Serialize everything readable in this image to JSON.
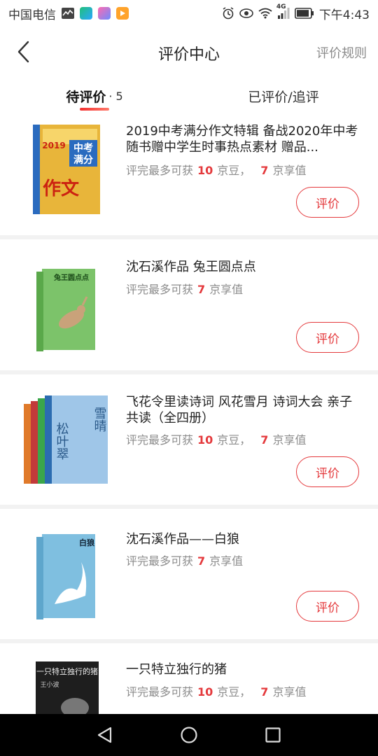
{
  "status_bar": {
    "carrier": "中国电信",
    "network": "4G",
    "time": "下午4:43"
  },
  "header": {
    "title": "评价中心",
    "rules_label": "评价规则"
  },
  "tabs": [
    {
      "label": "待评价",
      "count": "· 5"
    },
    {
      "label": "已评价/追评"
    }
  ],
  "items": [
    {
      "title": "2019中考满分作文特辑 备战2020年中考 随书赠中学生时事热点素材 赠品...",
      "reward_prefix": "评完最多可获",
      "bean_count": "10",
      "bean_label": "京豆，",
      "value_count": "7",
      "value_label": "京享值",
      "button": "评价"
    },
    {
      "title": "沈石溪作品 兔王圆点点",
      "reward_prefix": "评完最多可获",
      "value_count": "7",
      "value_label": "京享值",
      "button": "评价"
    },
    {
      "title": "飞花令里读诗词 风花雪月 诗词大会 亲子共读（全四册）",
      "reward_prefix": "评完最多可获",
      "bean_count": "10",
      "bean_label": "京豆，",
      "value_count": "7",
      "value_label": "京享值",
      "button": "评价"
    },
    {
      "title": "沈石溪作品——白狼",
      "reward_prefix": "评完最多可获",
      "value_count": "7",
      "value_label": "京享值",
      "button": "评价"
    },
    {
      "title": "一只特立独行的猪",
      "reward_prefix": "评完最多可获",
      "bean_count": "10",
      "bean_label": "京豆，",
      "value_count": "7",
      "value_label": "京享值"
    }
  ],
  "covers": {
    "book1": {
      "top": "中考",
      "bottom": "满分",
      "year": "2019",
      "side": "作文"
    },
    "book2": {
      "label": "兔王圆点点"
    },
    "book3": {
      "left": "松叶翠",
      "right": "雪晴"
    },
    "book4": {
      "label": "白狼"
    },
    "book5": {
      "label": "一只特立独行的猪",
      "author": "王小波"
    }
  },
  "colors": {
    "accent": "#e4393c",
    "muted": "#8c8c8c",
    "divider": "#f2f2f2"
  }
}
